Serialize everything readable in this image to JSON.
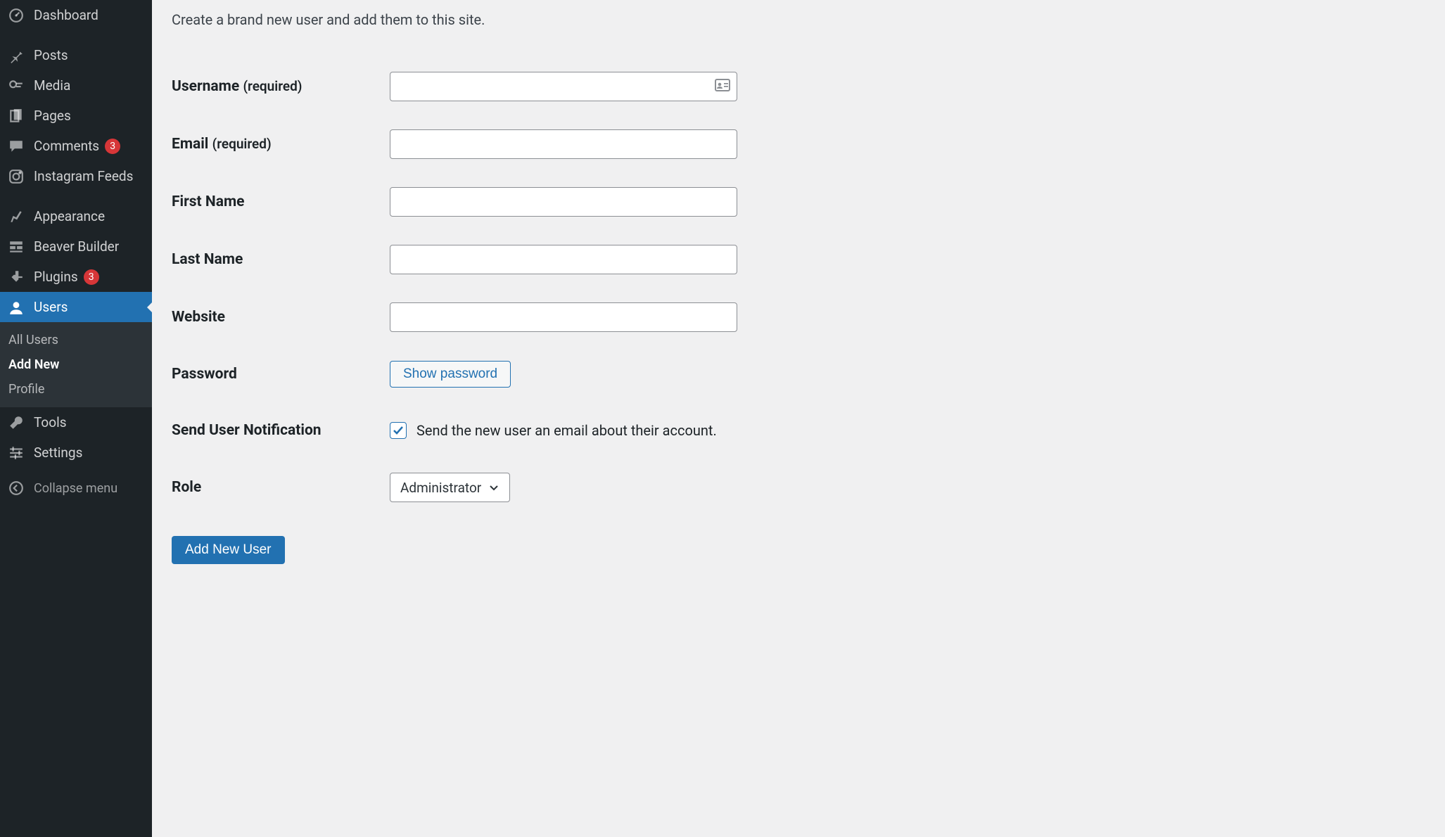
{
  "sidebar": {
    "items": [
      {
        "label": "Dashboard",
        "icon": "dashboard"
      },
      {
        "label": "Posts",
        "icon": "post"
      },
      {
        "label": "Media",
        "icon": "media"
      },
      {
        "label": "Pages",
        "icon": "pages"
      },
      {
        "label": "Comments",
        "icon": "comments",
        "badge": "3"
      },
      {
        "label": "Instagram Feeds",
        "icon": "instagram"
      },
      {
        "label": "Appearance",
        "icon": "appearance"
      },
      {
        "label": "Beaver Builder",
        "icon": "beaver"
      },
      {
        "label": "Plugins",
        "icon": "plugins",
        "badge": "3"
      },
      {
        "label": "Users",
        "icon": "users",
        "active": true
      },
      {
        "label": "Tools",
        "icon": "tools"
      },
      {
        "label": "Settings",
        "icon": "settings"
      }
    ],
    "submenu": [
      {
        "label": "All Users"
      },
      {
        "label": "Add New",
        "current": true
      },
      {
        "label": "Profile"
      }
    ],
    "collapse_label": "Collapse menu"
  },
  "page": {
    "intro": "Create a brand new user and add them to this site."
  },
  "form": {
    "username_label": "Username",
    "username_req": "(required)",
    "email_label": "Email",
    "email_req": "(required)",
    "first_name_label": "First Name",
    "last_name_label": "Last Name",
    "website_label": "Website",
    "password_label": "Password",
    "show_password_button": "Show password",
    "notification_label": "Send User Notification",
    "notification_text": "Send the new user an email about their account.",
    "notification_checked": true,
    "role_label": "Role",
    "role_value": "Administrator",
    "submit_label": "Add New User"
  }
}
